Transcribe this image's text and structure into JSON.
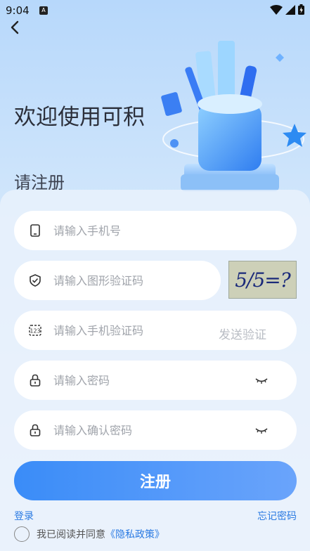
{
  "status_bar": {
    "time": "9:04",
    "badge": "A"
  },
  "header": {
    "back_icon": "chevron-left-icon"
  },
  "welcome": {
    "title": "欢迎使用可积",
    "subtitle": "请注册"
  },
  "form": {
    "phone": {
      "placeholder": "请输入手机号",
      "icon": "phone-icon"
    },
    "captcha": {
      "placeholder": "请输入图形验证码",
      "icon": "shield-check-icon",
      "image_text": "5/5=?"
    },
    "sms_code": {
      "placeholder": "请输入手机验证码",
      "icon": "number-123-icon",
      "send_label": "发送验证码"
    },
    "password": {
      "placeholder": "请输入密码",
      "icon": "lock-icon"
    },
    "confirm_password": {
      "placeholder": "请输入确认密码",
      "icon": "lock-icon"
    },
    "submit_label": "注册"
  },
  "links": {
    "login": "登录",
    "forgot": "忘记密码"
  },
  "agreement": {
    "text": "我已阅读并同意",
    "policy": "《隐私政策》"
  },
  "colors": {
    "accent": "#3a8cf8",
    "link": "#2a7ae2"
  }
}
